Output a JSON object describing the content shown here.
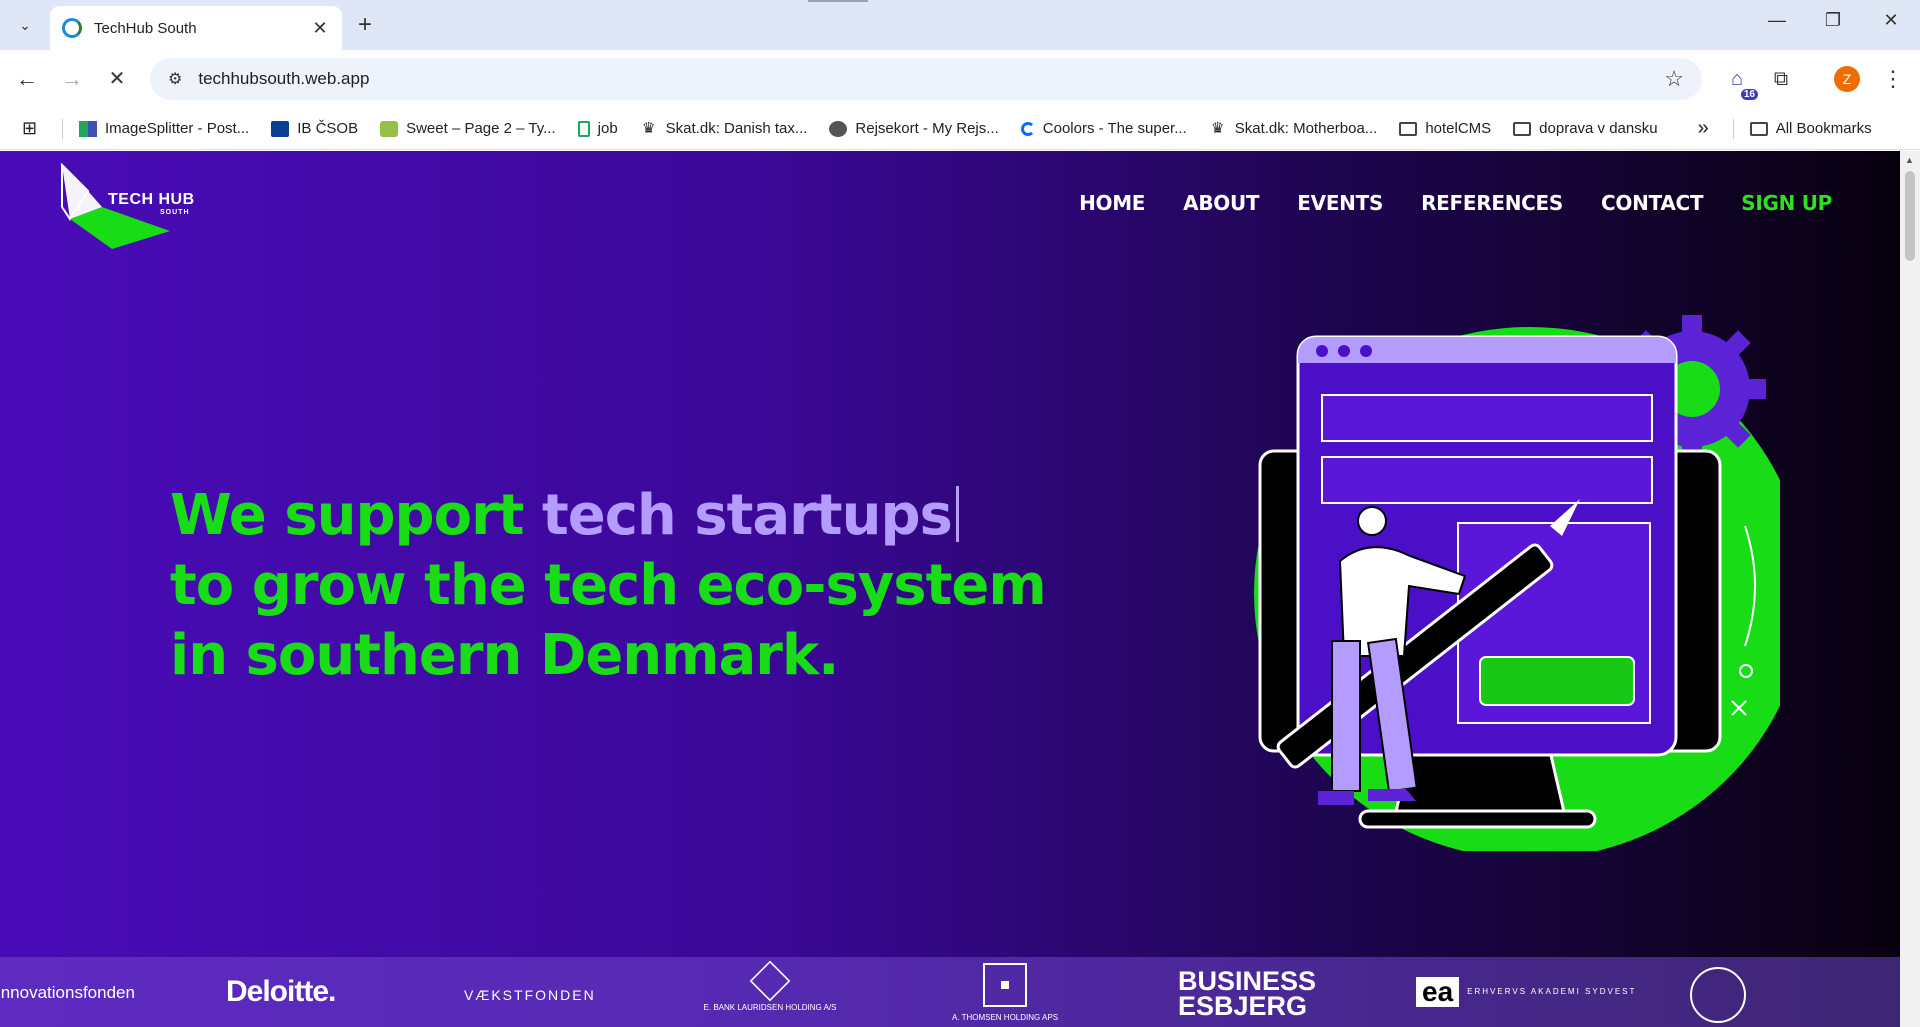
{
  "browser": {
    "tab_title": "TechHub South",
    "url": "techhubsouth.web.app",
    "extension_badge": "16",
    "profile_initial": "Z",
    "bookmarks": [
      {
        "label": "ImageSplitter - Post...",
        "icon": "imagesplitter-icon"
      },
      {
        "label": "IB ČSOB",
        "icon": "csob-icon"
      },
      {
        "label": "Sweet – Page 2 – Ty...",
        "icon": "shopify-icon"
      },
      {
        "label": "job",
        "icon": "doc-icon"
      },
      {
        "label": "Skat.dk: Danish tax...",
        "icon": "crown-icon"
      },
      {
        "label": "Rejsekort - My Rejs...",
        "icon": "globe-icon"
      },
      {
        "label": "Coolors - The super...",
        "icon": "coolors-icon"
      },
      {
        "label": "Skat.dk: Motherboa...",
        "icon": "crown-icon"
      },
      {
        "label": "hotelCMS",
        "icon": "folder-icon"
      },
      {
        "label": "doprava v dansku",
        "icon": "folder-icon"
      }
    ],
    "all_bookmarks": "All Bookmarks",
    "more_bookmarks": "»"
  },
  "site": {
    "logo_text": "TECH HUB",
    "logo_sub": "SOUTH",
    "nav": {
      "home": "HOME",
      "about": "ABOUT",
      "events": "EVENTS",
      "references": "REFERENCES",
      "contact": "CONTACT",
      "signup": "SIGN UP"
    },
    "hero": {
      "line1_a": "We support ",
      "line1_b": "tech startups",
      "line2": "to grow the tech eco-system",
      "line3": "in southern Denmark."
    },
    "partners": {
      "innovationsfonden": "Innovationsfonden",
      "deloitte": "Deloitte.",
      "vaekstfonden": "VÆKSTFONDEN",
      "bank_lauridsen": "E. BANK LAURIDSEN HOLDING A/S",
      "thomsen": "A. THOMSEN HOLDING APS",
      "business_esbjerg_1": "BUSINESS",
      "business_esbjerg_2": "ESBJERG",
      "ea": "ea",
      "erhvervs": "ERHVERVS AKADEMI SYDVEST"
    }
  },
  "colors": {
    "accent_green": "#17dc16",
    "accent_purple": "#b49cff",
    "bg_purple": "#4a0cb8"
  }
}
